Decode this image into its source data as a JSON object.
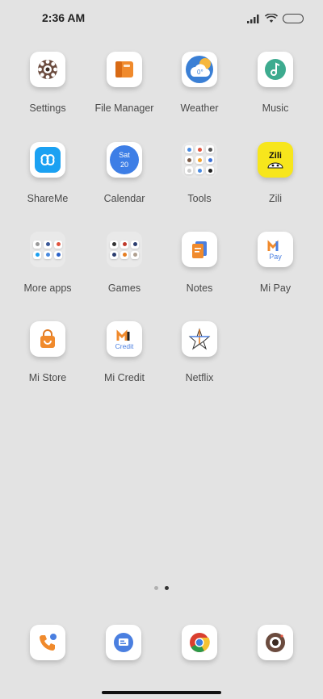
{
  "status_bar": {
    "time": "2:36 AM",
    "signal_icon": "signal-icon",
    "wifi_icon": "wifi-icon",
    "battery_icon": "battery-icon"
  },
  "apps": [
    {
      "label": "Settings"
    },
    {
      "label": "File Manager"
    },
    {
      "label": "Weather",
      "badge": "0°"
    },
    {
      "label": "Music"
    },
    {
      "label": "ShareMe"
    },
    {
      "label": "Calendar",
      "day": "Sat",
      "date": "20"
    },
    {
      "label": "Tools"
    },
    {
      "label": "Zili",
      "logo_text": "Zili"
    },
    {
      "label": "More apps"
    },
    {
      "label": "Games"
    },
    {
      "label": "Notes"
    },
    {
      "label": "Mi Pay",
      "logo_text": "Pay"
    },
    {
      "label": "Mi Store"
    },
    {
      "label": "Mi Credit",
      "logo_text": "Credit"
    },
    {
      "label": "Netflix"
    }
  ],
  "pages": {
    "count": 2,
    "active": 2
  },
  "dock": [
    "phone-icon",
    "messages-icon",
    "chrome-icon",
    "camera-icon"
  ]
}
